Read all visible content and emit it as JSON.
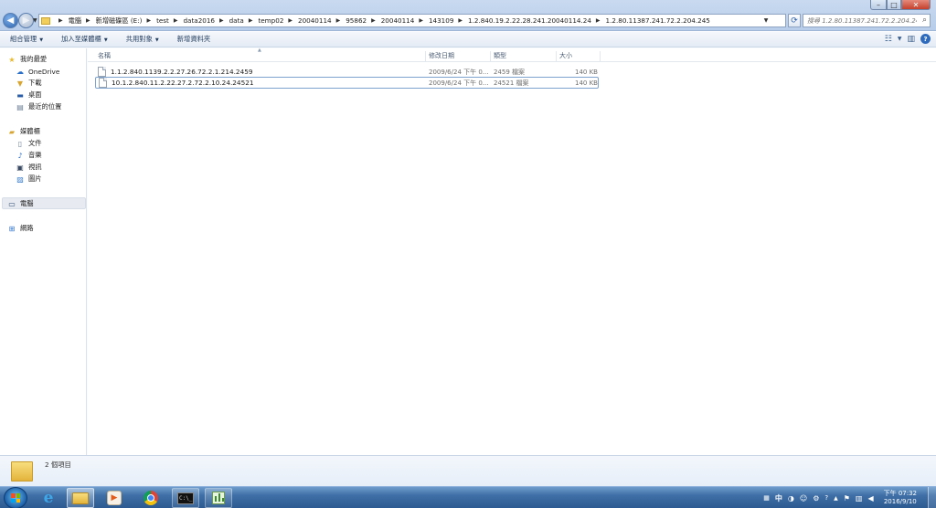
{
  "window": {
    "controls": {
      "minimize": "–",
      "maximize": "□",
      "close": "✕"
    }
  },
  "address": {
    "crumbs": [
      "電腦",
      "新增磁碟區 (E:)",
      "test",
      "data2016",
      "data",
      "temp02",
      "20040114",
      "95862",
      "20040114",
      "143109",
      "1.2.840.19.2.22.28.241.20040114.24",
      "1.2.80.11387.241.72.2.204.245"
    ],
    "search_placeholder": "搜尋 1.2.80.11387.241.72.2.204.245"
  },
  "toolbar": {
    "organize": "組合管理",
    "add_to_library": "加入至媒體櫃",
    "share_with": "共用對象",
    "new_folder": "新增資料夾"
  },
  "nav": {
    "favorites": "我的最愛",
    "onedrive": "OneDrive",
    "downloads": "下載",
    "desktop": "桌面",
    "recent": "最近的位置",
    "libraries": "媒體櫃",
    "documents": "文件",
    "music": "音樂",
    "videos": "視訊",
    "pictures": "圖片",
    "computer": "電腦",
    "network": "網路"
  },
  "columns": {
    "name": "名稱",
    "modified": "修改日期",
    "type": "類型",
    "size": "大小"
  },
  "files": [
    {
      "name": "1.1.2.840.1139.2.2.27.26.72.2.1.214.2459",
      "modified": "2009/6/24 下午 0...",
      "type": "2459 檔案",
      "size": "140 KB",
      "selected": false
    },
    {
      "name": "10.1.2.840.11.2.22.27.2.72.2.10.24.24521",
      "modified": "2009/6/24 下午 0...",
      "type": "24521 檔案",
      "size": "140 KB",
      "selected": true
    }
  ],
  "details": {
    "count": "2 個項目"
  },
  "taskbar": {
    "time": "下午 07:32",
    "date": "2016/9/10",
    "ime": "中"
  },
  "colors": {
    "accent": "#2c63ae",
    "taskbar": "#3f6fa6",
    "selection_border": "#7da2ce"
  }
}
